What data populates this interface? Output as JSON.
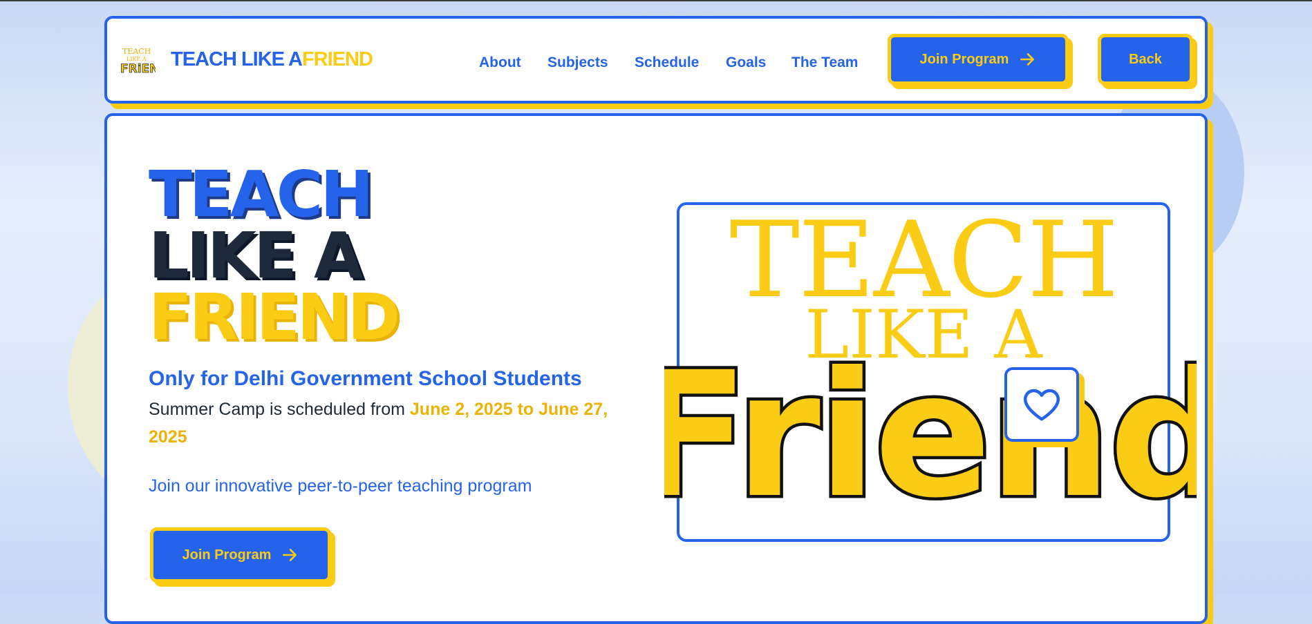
{
  "brand": {
    "logo_text": "TEACH LIKE A FRIEND",
    "name_part1": "TEACH LIKE A",
    "name_part2": "FRIEND"
  },
  "nav": {
    "items": [
      {
        "label": "About"
      },
      {
        "label": "Subjects"
      },
      {
        "label": "Schedule"
      },
      {
        "label": "Goals"
      },
      {
        "label": "The Team"
      }
    ],
    "join_label": "Join Program",
    "back_label": "Back"
  },
  "hero": {
    "title_line1": "TEACH",
    "title_line2": "LIKE A",
    "title_line3": "FRIEND",
    "subtitle": "Only for Delhi Government School Students",
    "schedule_prefix": "Summer Camp is scheduled from ",
    "schedule_dates": "June 2, 2025 to June 27, 2025",
    "tagline": "Join our innovative peer-to-peer teaching program",
    "cta_label": "Join Program"
  },
  "art": {
    "line1": "TEACH",
    "line2": "LIKE A",
    "line3": "Friend"
  },
  "colors": {
    "primary": "#2563eb",
    "accent": "#facc15",
    "dark": "#1e293b"
  },
  "icons": [
    "logo-icon",
    "arrow-right-icon",
    "heart-icon"
  ]
}
